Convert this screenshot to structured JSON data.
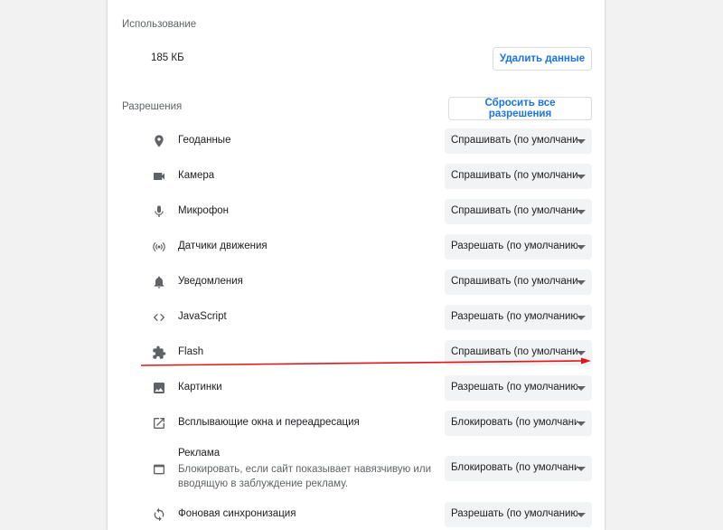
{
  "usage": {
    "title": "Использование",
    "value": "185 КБ",
    "clear_button": "Удалить данные"
  },
  "permissions": {
    "title": "Разрешения",
    "reset_button": "Сбросить все разрешения",
    "items": [
      {
        "icon": "location-pin-icon",
        "label": "Геоданные",
        "value": "Спрашивать (по умолчанию)"
      },
      {
        "icon": "camera-icon",
        "label": "Камера",
        "value": "Спрашивать (по умолчанию)"
      },
      {
        "icon": "microphone-icon",
        "label": "Микрофон",
        "value": "Спрашивать (по умолчанию)"
      },
      {
        "icon": "motion-sensors-icon",
        "label": "Датчики движения",
        "value": "Разрешать (по умолчанию)"
      },
      {
        "icon": "bell-icon",
        "label": "Уведомления",
        "value": "Спрашивать (по умолчанию)"
      },
      {
        "icon": "code-icon",
        "label": "JavaScript",
        "value": "Разрешать (по умолчанию)"
      },
      {
        "icon": "puzzle-icon",
        "label": "Flash",
        "value": "Спрашивать (по умолчанию)"
      },
      {
        "icon": "image-icon",
        "label": "Картинки",
        "value": "Разрешать (по умолчанию)"
      },
      {
        "icon": "open-in-new-icon",
        "label": "Всплывающие окна и переадресация",
        "value": "Блокировать (по умолчанию)"
      },
      {
        "icon": "ad-window-icon",
        "label": "Реклама",
        "sublabel": "Блокировать, если сайт показывает навязчивую или вводящую в заблуждение рекламу.",
        "value": "Блокировать (по умолчанию)"
      },
      {
        "icon": "sync-icon",
        "label": "Фоновая синхронизация",
        "value": "Разрешать (по умолчанию)"
      }
    ]
  },
  "colors": {
    "accent": "#1a73e8",
    "annotation_arrow": "#e0161b"
  }
}
